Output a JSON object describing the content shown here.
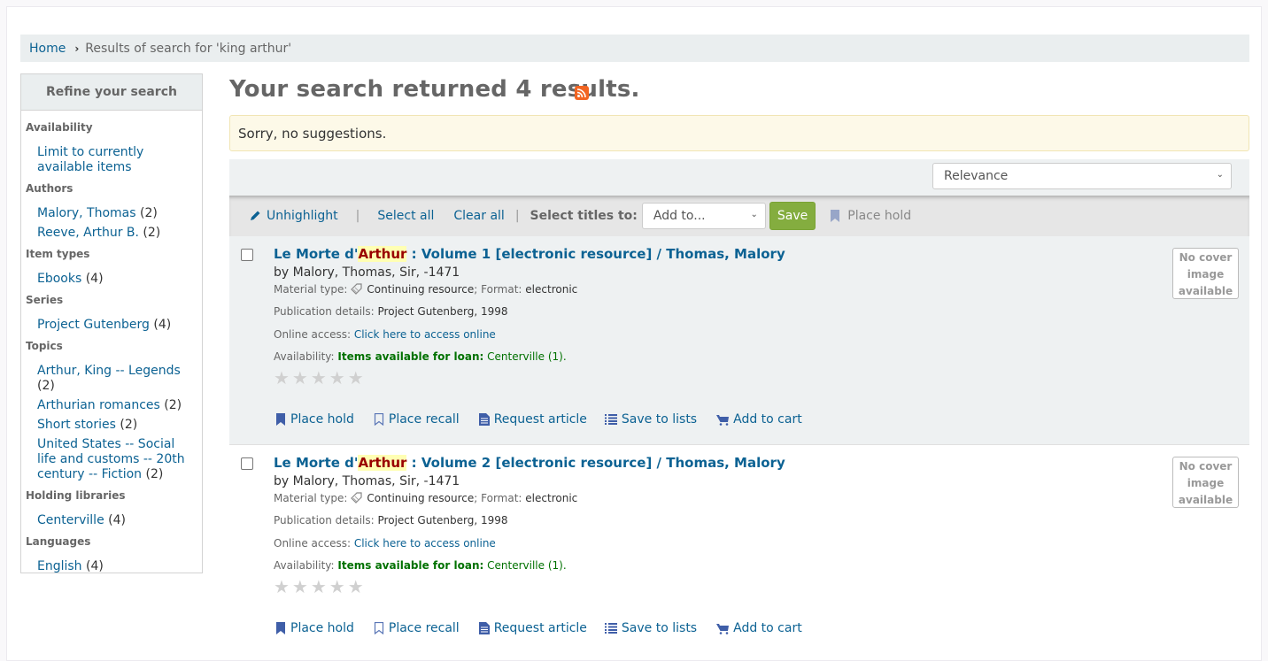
{
  "breadcrumb": {
    "home": "Home",
    "current": "Results of search for 'king arthur'"
  },
  "refine": {
    "title": "Refine your search",
    "facets": [
      {
        "title": "Availability",
        "items": [
          {
            "label": "Limit to currently available items",
            "count": ""
          }
        ]
      },
      {
        "title": "Authors",
        "items": [
          {
            "label": "Malory, Thomas",
            "count": "(2)"
          },
          {
            "label": "Reeve, Arthur B.",
            "count": "(2)"
          }
        ]
      },
      {
        "title": "Item types",
        "items": [
          {
            "label": "Ebooks",
            "count": "(4)"
          }
        ]
      },
      {
        "title": "Series",
        "items": [
          {
            "label": "Project Gutenberg",
            "count": "(4)"
          }
        ]
      },
      {
        "title": "Topics",
        "items": [
          {
            "label": "Arthur, King -- Legends",
            "count": "(2)"
          },
          {
            "label": "Arthurian romances",
            "count": "(2)"
          },
          {
            "label": "Short stories",
            "count": "(2)"
          },
          {
            "label": "United States -- Social life and customs -- 20th century -- Fiction",
            "count": "(2)"
          }
        ]
      },
      {
        "title": "Holding libraries",
        "items": [
          {
            "label": "Centerville",
            "count": "(4)"
          }
        ]
      },
      {
        "title": "Languages",
        "items": [
          {
            "label": "English",
            "count": "(4)"
          }
        ]
      }
    ]
  },
  "main": {
    "heading": "Your search returned 4 results.",
    "rss_icon": "rss-feed-icon",
    "suggestions": "Sorry, no suggestions.",
    "sort": {
      "selected": "Relevance"
    },
    "toolbar": {
      "unhighlight": "Unhighlight",
      "select_all": "Select all",
      "clear_all": "Clear all",
      "select_titles_label": "Select titles to:",
      "add_to_selected": "Add to...",
      "save": "Save",
      "place_hold": "Place hold"
    },
    "results": [
      {
        "title_prefix": "Le Morte d'",
        "title_highlight": "Arthur",
        "title_suffix": " : Volume 1 [electronic resource] / Thomas, Malory",
        "byline": "by Malory, Thomas, Sir, -1471",
        "material_label": "Material type:",
        "material_value": "Continuing resource",
        "format_label": "; Format:",
        "format_value": "electronic",
        "pub_label": "Publication details:",
        "pub_value": "Project Gutenberg, 1998",
        "online_label": "Online access:",
        "online_link": "Click here to access online",
        "avail_label": "Availability:",
        "avail_status": "Items available for loan:",
        "avail_location": "Centerville (1).",
        "rating": 0,
        "no_cover": "No cover image available"
      },
      {
        "title_prefix": "Le Morte d'",
        "title_highlight": "Arthur",
        "title_suffix": " : Volume 2 [electronic resource] / Thomas, Malory",
        "byline": "by Malory, Thomas, Sir, -1471",
        "material_label": "Material type:",
        "material_value": "Continuing resource",
        "format_label": "; Format:",
        "format_value": "electronic",
        "pub_label": "Publication details:",
        "pub_value": "Project Gutenberg, 1998",
        "online_label": "Online access:",
        "online_link": "Click here to access online",
        "avail_label": "Availability:",
        "avail_status": "Items available for loan:",
        "avail_location": "Centerville (1).",
        "rating": 0,
        "no_cover": "No cover image available"
      }
    ],
    "actions": {
      "place_hold": "Place hold",
      "place_recall": "Place recall",
      "request_article": "Request article",
      "save_to_lists": "Save to lists",
      "add_to_cart": "Add to cart"
    },
    "stars": "★★★★★"
  },
  "colors": {
    "link": "#0c6293",
    "save_button": "#84ad3f",
    "available_green": "#007100",
    "highlight_bg": "#ffffb3",
    "highlight_text": "#990000",
    "rss": "#f26522"
  }
}
